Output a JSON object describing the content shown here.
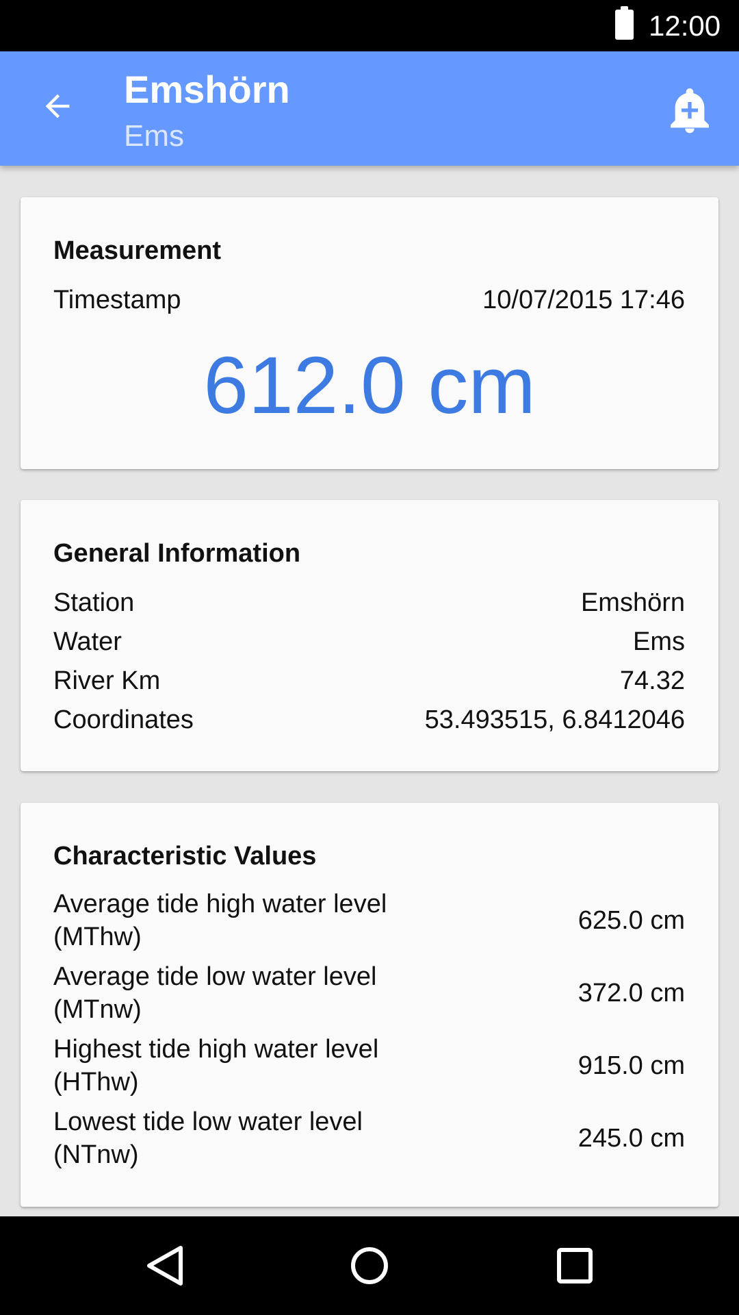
{
  "status_bar": {
    "time": "12:00",
    "battery_icon": "battery-full-icon"
  },
  "app_bar": {
    "title": "Emshörn",
    "subtitle": "Ems",
    "back_icon": "arrow-back-icon",
    "action_icon": "add-alarm-bell-icon",
    "color": "#6699ff"
  },
  "measurement": {
    "heading": "Measurement",
    "timestamp_label": "Timestamp",
    "timestamp_value": "10/07/2015 17:46",
    "value": "612.0 cm",
    "value_color": "#3d7be3"
  },
  "general": {
    "heading": "General Information",
    "rows": [
      {
        "label": "Station",
        "value": "Emshörn"
      },
      {
        "label": "Water",
        "value": "Ems"
      },
      {
        "label": "River Km",
        "value": "74.32"
      },
      {
        "label": "Coordinates",
        "value": "53.493515, 6.8412046"
      }
    ]
  },
  "characteristic": {
    "heading": "Characteristic Values",
    "rows": [
      {
        "label": "Average tide high water level (MThw)",
        "value": "625.0 cm"
      },
      {
        "label": "Average tide low water level (MTnw)",
        "value": "372.0 cm"
      },
      {
        "label": "Highest tide high water level (HThw)",
        "value": "915.0 cm"
      },
      {
        "label": "Lowest tide low water level (NTnw)",
        "value": "245.0 cm"
      }
    ]
  },
  "nav_bar": {
    "back_icon": "nav-back-triangle-icon",
    "home_icon": "nav-home-circle-icon",
    "recents_icon": "nav-recents-square-icon"
  }
}
